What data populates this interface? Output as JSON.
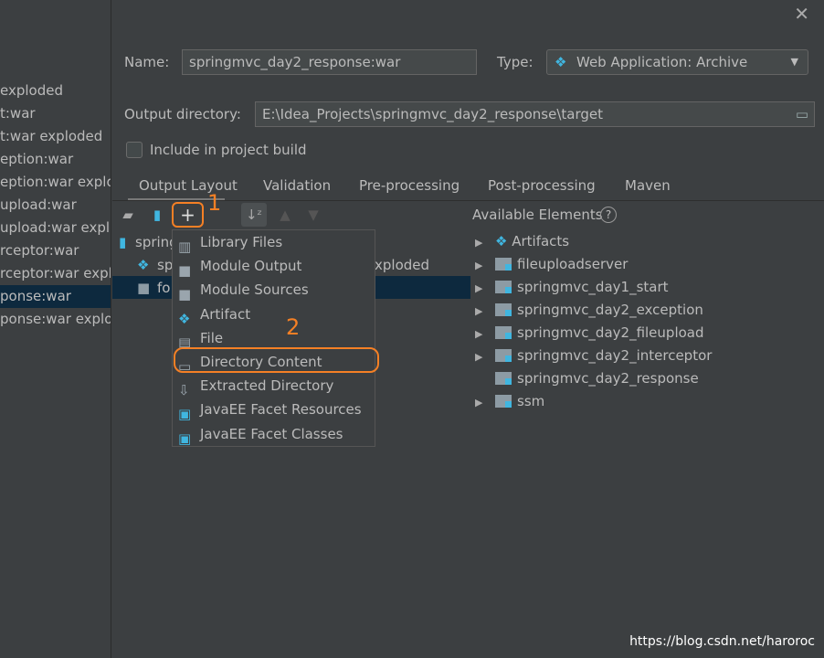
{
  "sidebar": {
    "items": [
      "exploded",
      "t:war",
      "t:war exploded",
      "eption:war",
      "eption:war exploded",
      "upload:war",
      "upload:war exploded",
      "rceptor:war",
      "rceptor:war exploded",
      "ponse:war",
      "ponse:war exploded"
    ],
    "selected_index": 9
  },
  "form": {
    "name_label": "Name:",
    "name_value": "springmvc_day2_response:war",
    "type_label": "Type:",
    "type_value": "Web Application: Archive",
    "output_label": "Output directory:",
    "output_value": "E:\\Idea_Projects\\springmvc_day2_response\\target",
    "include_label": "Include in project build",
    "include_checked": false
  },
  "tabs": [
    "Output Layout",
    "Validation",
    "Pre-processing",
    "Post-processing",
    "Maven"
  ],
  "tree": {
    "root": "spring",
    "child1": "sp",
    "child1_tail": "xploded",
    "child2": "fo"
  },
  "menu": {
    "items": [
      "Library Files",
      "Module Output",
      "Module Sources",
      "Artifact",
      "File",
      "Directory Content",
      "Extracted Directory",
      "JavaEE Facet Resources",
      "JavaEE Facet Classes"
    ]
  },
  "annotations": {
    "one": "1",
    "two": "2"
  },
  "available": {
    "title": "Available Elements",
    "items": [
      {
        "label": "Artifacts",
        "arrow": true
      },
      {
        "label": "fileuploadserver",
        "arrow": true
      },
      {
        "label": "springmvc_day1_start",
        "arrow": true
      },
      {
        "label": "springmvc_day2_exception",
        "arrow": true
      },
      {
        "label": "springmvc_day2_fileupload",
        "arrow": true
      },
      {
        "label": "springmvc_day2_interceptor",
        "arrow": true
      },
      {
        "label": "springmvc_day2_response",
        "arrow": false
      },
      {
        "label": "ssm",
        "arrow": true
      }
    ]
  },
  "watermark": "https://blog.csdn.net/haroroc",
  "colors": {
    "accent": "#f58025",
    "selection": "#0d293e",
    "background": "#3c3f41"
  }
}
